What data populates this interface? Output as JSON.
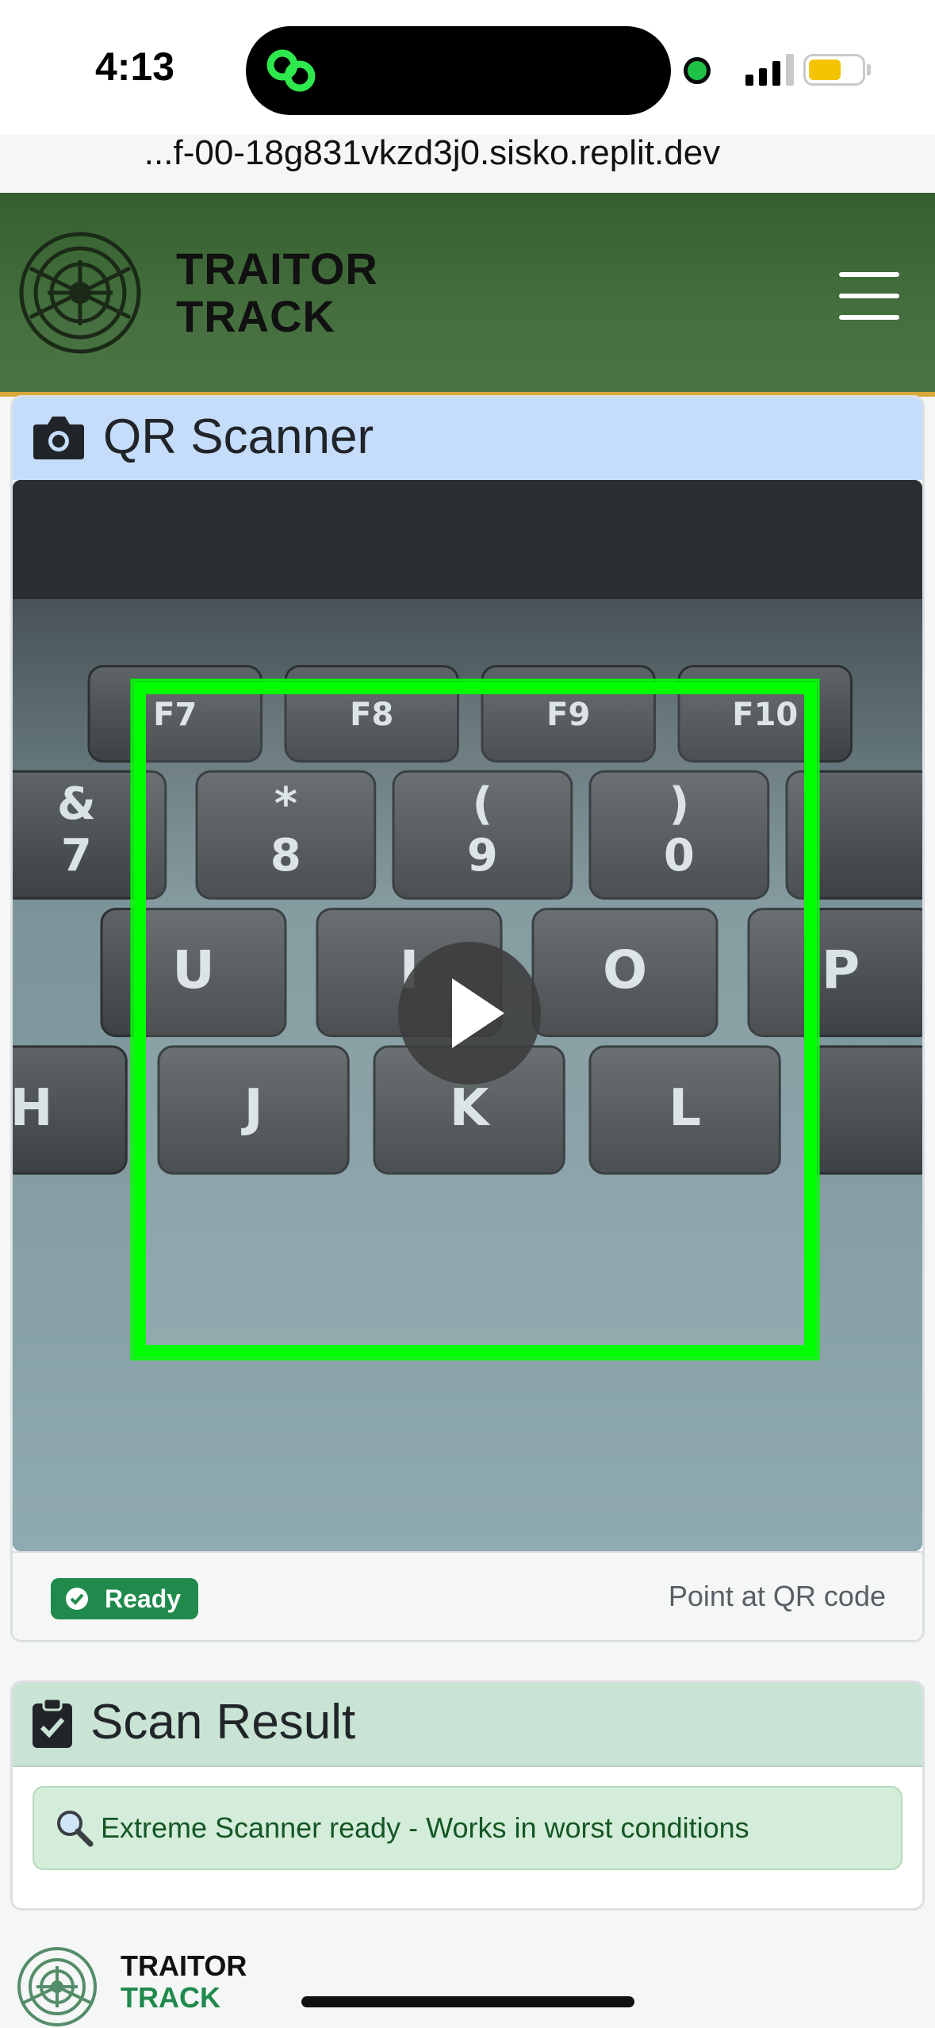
{
  "status_bar": {
    "time": "4:13"
  },
  "browser": {
    "url": "...f-00-18g831vkzd3j0.sisko.replit.dev"
  },
  "header": {
    "brand_line1": "TRAITOR",
    "brand_line2": "TRACK",
    "menu_icon": "hamburger-menu-icon"
  },
  "scanner": {
    "title": "QR Scanner",
    "icon": "camera-icon",
    "status_badge": "Ready",
    "hint": "Point at QR code",
    "play_icon": "play-icon",
    "frame_color": "#00ff00",
    "key_labels": [
      "F7",
      "F8",
      "F9",
      "F10",
      "&",
      "7",
      "*",
      "8",
      "(",
      "9",
      ")",
      "0",
      "U",
      "I",
      "O",
      "P",
      "H",
      "J",
      "K",
      "L"
    ]
  },
  "result": {
    "title": "Scan Result",
    "icon": "clipboard-check-icon",
    "message": "Extreme Scanner ready - Works in worst conditions",
    "message_icon": "magnifier-icon"
  },
  "footer": {
    "brand_line1": "TRAITOR",
    "brand_line2": "TRACK"
  },
  "colors": {
    "header_green": "#466f3f",
    "accent_gold": "#d9a73a",
    "success": "#1f8a4c",
    "info_blue": "#c5dcfb"
  }
}
